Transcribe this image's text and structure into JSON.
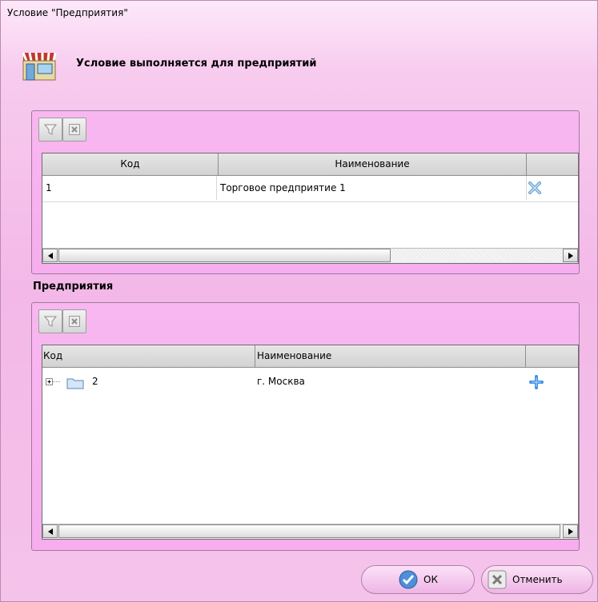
{
  "window": {
    "title": "Условие \"Предприятия\""
  },
  "header": {
    "text": "Условие выполняется для предприятий",
    "icon": "shop-icon"
  },
  "selected": {
    "columns": {
      "code": "Код",
      "name": "Наименование"
    },
    "rows": [
      {
        "code": "1",
        "name": "Торговое предприятие 1",
        "action_icon": "remove-icon"
      }
    ]
  },
  "enterprises": {
    "label": "Предприятия",
    "columns": {
      "code": "Код",
      "name": "Наименование"
    },
    "rows": [
      {
        "code": "2",
        "name": "г. Москва",
        "action_icon": "add-icon",
        "expander": "+"
      }
    ]
  },
  "buttons": {
    "ok": "ОК",
    "cancel": "Отменить"
  },
  "colors": {
    "accent": "#f3b8e8",
    "add_icon": "#3f8fe0",
    "remove_icon": "#6aa2d6"
  }
}
